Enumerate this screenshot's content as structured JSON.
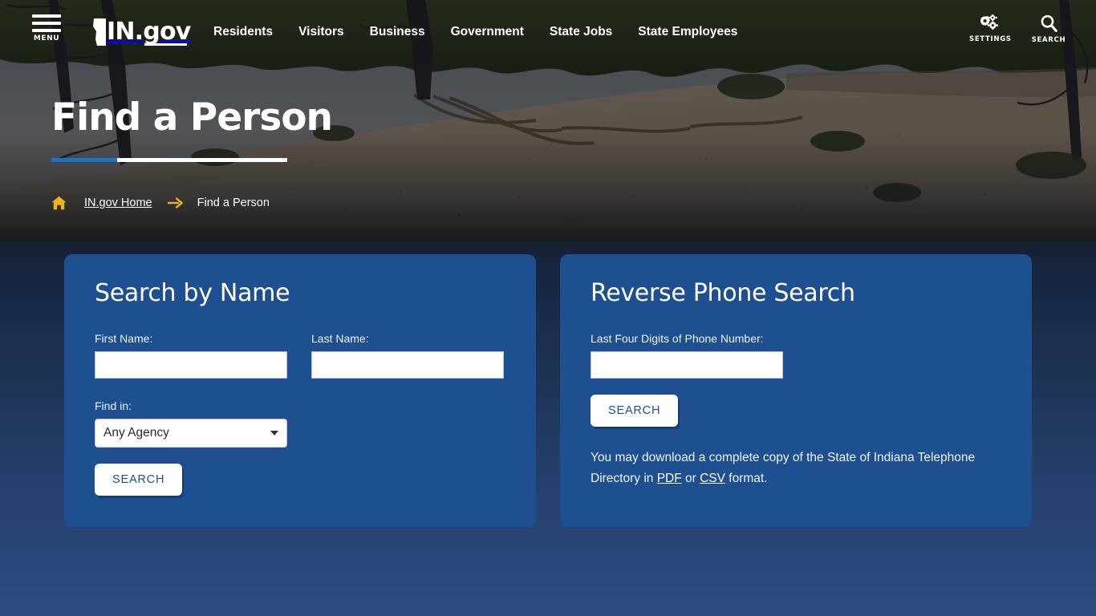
{
  "header": {
    "menu_label": "MENU",
    "logo_text": "IN.gov",
    "nav": [
      {
        "label": "Residents"
      },
      {
        "label": "Visitors"
      },
      {
        "label": "Business"
      },
      {
        "label": "Government"
      },
      {
        "label": "State Jobs"
      },
      {
        "label": "State Employees"
      }
    ],
    "tools": [
      {
        "label": "SETTINGS",
        "icon": "gears-icon"
      },
      {
        "label": "SEARCH",
        "icon": "magnifier-icon"
      }
    ]
  },
  "hero": {
    "title": "Find a Person",
    "accent_color": "#1a73c4",
    "breadcrumb": {
      "home_label": "IN.gov Home",
      "current": "Find a Person",
      "home_icon": "house-icon",
      "separator_icon": "arrow-right-icon",
      "icon_color": "#f0b323"
    }
  },
  "cards": {
    "card_color": "#1d4f91",
    "name_search": {
      "title": "Search by Name",
      "first_name_label": "First Name:",
      "first_name_value": "",
      "first_name_placeholder": "",
      "last_name_label": "Last Name:",
      "last_name_value": "",
      "last_name_placeholder": "",
      "find_in_label": "Find in:",
      "find_in_selected": "Any Agency",
      "search_button": "SEARCH"
    },
    "phone_search": {
      "title": "Reverse Phone Search",
      "digits_label": "Last Four Digits of Phone Number:",
      "digits_value": "",
      "digits_placeholder": "",
      "search_button": "SEARCH",
      "note_part1": "You may download a complete copy of the State of Indiana Telephone Directory in ",
      "note_link_pdf": "PDF",
      "note_part2": " or ",
      "note_link_csv": "CSV",
      "note_part3": " format."
    }
  }
}
